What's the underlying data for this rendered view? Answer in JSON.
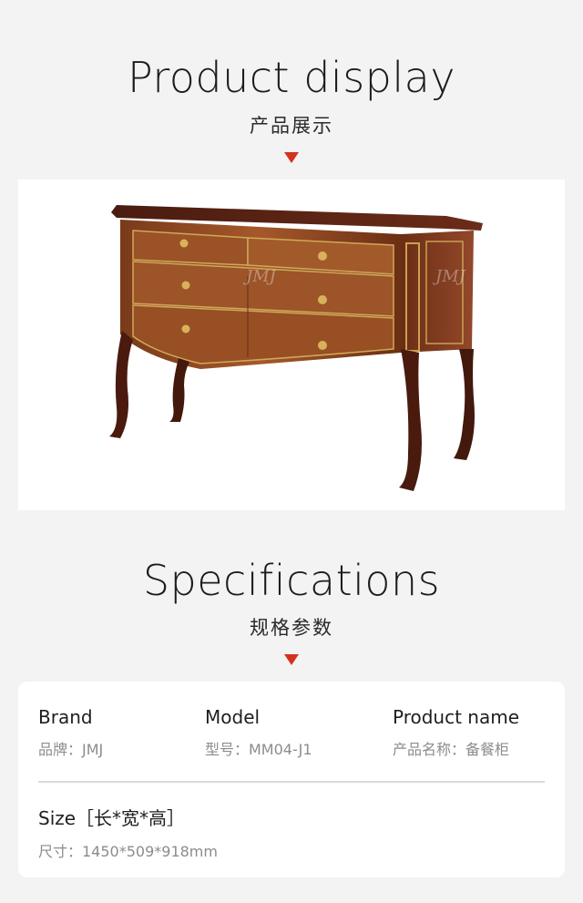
{
  "colors": {
    "background": "#f3f3f3",
    "accent_arrow": "#d3321e",
    "card": "#ffffff"
  },
  "product_display": {
    "title": "Product display",
    "subtitle": "产品展示",
    "arrow_icon": "triangle-down-icon",
    "image_alt": "sideboard-cabinet-photo",
    "watermark": "JMJ"
  },
  "specifications": {
    "title": "Specifications",
    "subtitle": "规格参数",
    "arrow_icon": "triangle-down-icon",
    "brand": {
      "label": "Brand",
      "value": "品牌：JMJ"
    },
    "model": {
      "label": "Model",
      "value": "型号：MM04-J1"
    },
    "product_name": {
      "label": "Product name",
      "value": "产品名称：备餐柜"
    },
    "size": {
      "label": "Size［长*宽*高］",
      "value": "尺寸：1450*509*918mm"
    }
  }
}
